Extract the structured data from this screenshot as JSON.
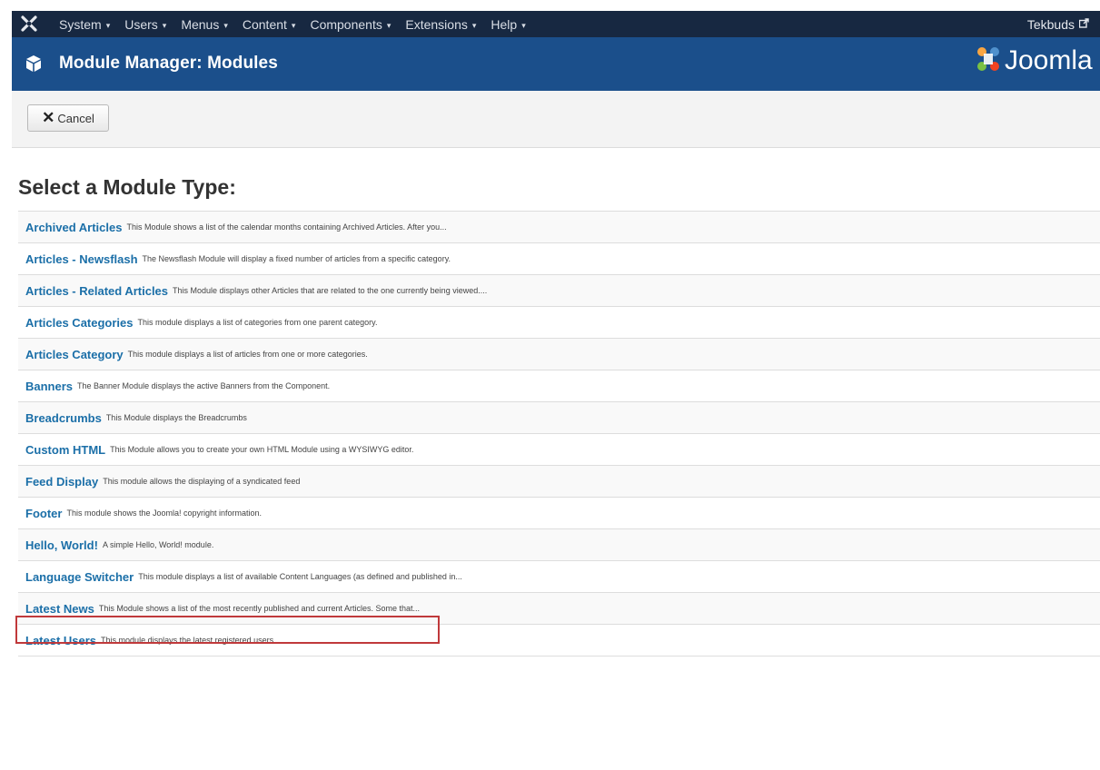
{
  "navbar": {
    "logo_icon": "joomla-x-icon",
    "menu": [
      {
        "label": "System"
      },
      {
        "label": "Users"
      },
      {
        "label": "Menus"
      },
      {
        "label": "Content"
      },
      {
        "label": "Components"
      },
      {
        "label": "Extensions"
      },
      {
        "label": "Help"
      }
    ],
    "caret": "▾",
    "user": "Tekbuds",
    "user_icon": "external-link-icon"
  },
  "titlebar": {
    "icon": "cube-icon",
    "title": "Module Manager: Modules",
    "brand": "Joomla"
  },
  "toolbar": {
    "cancel_label": "Cancel",
    "cancel_icon": "close-icon"
  },
  "heading": "Select a Module Type:",
  "modules": [
    {
      "name": "Archived Articles",
      "desc": "This Module shows a list of the calendar months containing Archived Articles. After you..."
    },
    {
      "name": "Articles - Newsflash",
      "desc": "The Newsflash Module will display a fixed number of articles from a specific category."
    },
    {
      "name": "Articles - Related Articles",
      "desc": "This Module displays other Articles that are related to the one currently being viewed...."
    },
    {
      "name": "Articles Categories",
      "desc": "This module displays a list of categories from one parent category."
    },
    {
      "name": "Articles Category",
      "desc": "This module displays a list of articles from one or more categories."
    },
    {
      "name": "Banners",
      "desc": "The Banner Module displays the active Banners from the Component."
    },
    {
      "name": "Breadcrumbs",
      "desc": "This Module displays the Breadcrumbs"
    },
    {
      "name": "Custom HTML",
      "desc": "This Module allows you to create your own HTML Module using a WYSIWYG editor."
    },
    {
      "name": "Feed Display",
      "desc": "This module allows the displaying of a syndicated feed"
    },
    {
      "name": "Footer",
      "desc": "This module shows the Joomla! copyright information."
    },
    {
      "name": "Hello, World!",
      "desc": "A simple Hello, World! module."
    },
    {
      "name": "Language Switcher",
      "desc": "This module displays a list of available Content Languages (as defined and published in..."
    },
    {
      "name": "Latest News",
      "desc": "This Module shows a list of the most recently published and current Articles. Some that..."
    },
    {
      "name": "Latest Users",
      "desc": "This module displays the latest registered users"
    }
  ],
  "colors": {
    "navbar": "#172841",
    "titlebar": "#1b4f8b",
    "link": "#1b6fa8",
    "highlight": "#c0393b"
  }
}
